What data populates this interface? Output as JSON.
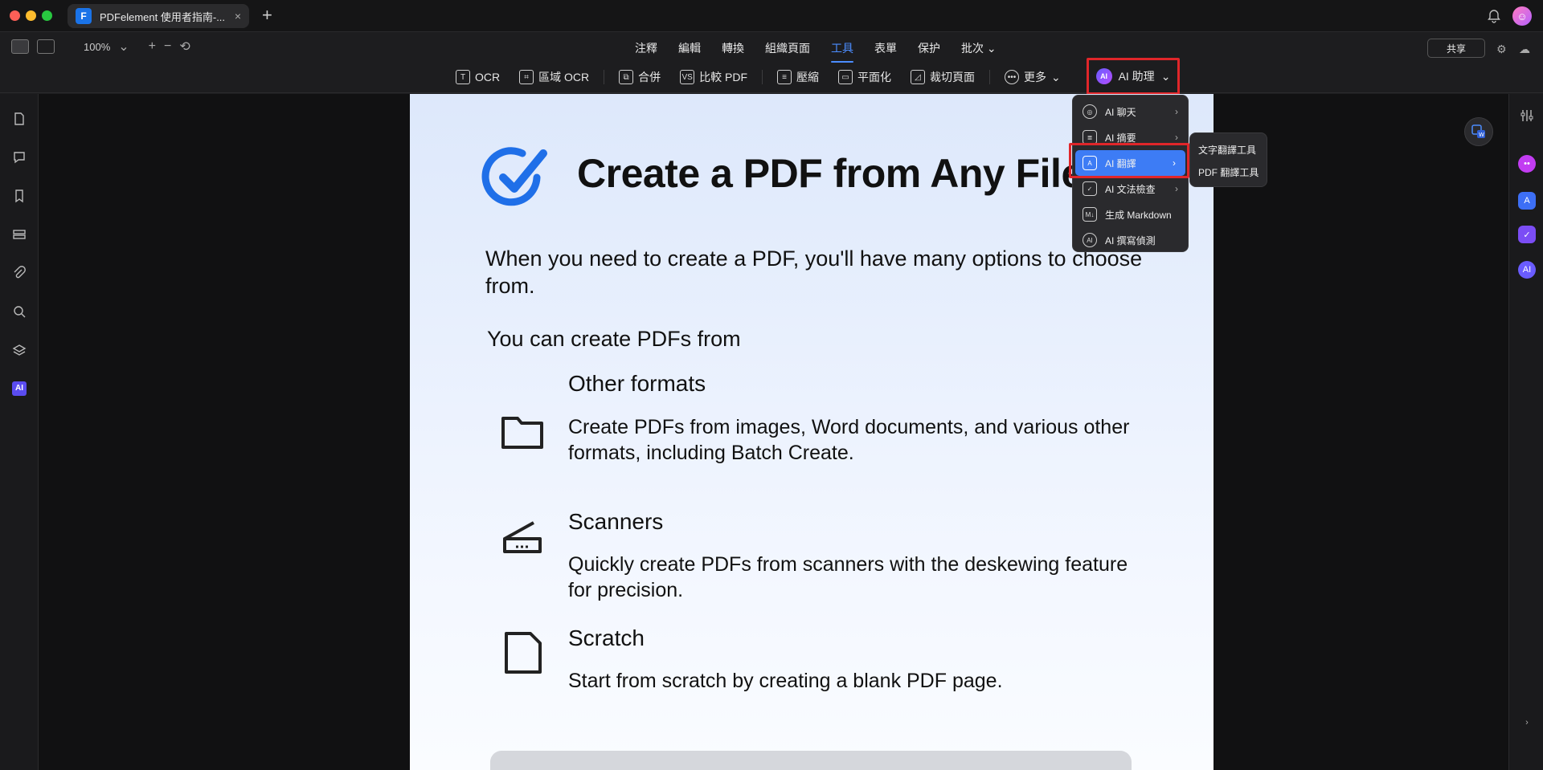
{
  "tab": {
    "title": "PDFelement 使用者指南-...",
    "close": "×"
  },
  "new_tab": "+",
  "zoom": {
    "value": "100%",
    "chevron": "⌄",
    "plus": "+",
    "minus": "−"
  },
  "menu": [
    "注釋",
    "編輯",
    "轉換",
    "組織頁面",
    "工具",
    "表單",
    "保护",
    "批次"
  ],
  "menu_active_index": 4,
  "menu_more_chevron": "⌄",
  "share_label": "共享",
  "tools": {
    "ocr": "OCR",
    "area_ocr": "區域 OCR",
    "merge": "合併",
    "compare": "比較 PDF",
    "compress": "壓縮",
    "flatten": "平面化",
    "crop": "裁切頁面",
    "more": "更多",
    "ai_assistant": "AI 助理",
    "ai_badge": "AI"
  },
  "ai_menu": [
    {
      "label": "AI 聊天",
      "icon": "ai-chat-icon",
      "has_submenu": true
    },
    {
      "label": "AI 摘要",
      "icon": "ai-summary-icon",
      "has_submenu": true
    },
    {
      "label": "AI 翻譯",
      "icon": "ai-translate-icon",
      "has_submenu": true,
      "highlighted": true
    },
    {
      "label": "AI 文法檢查",
      "icon": "ai-grammar-icon",
      "has_submenu": true
    },
    {
      "label": "生成 Markdown",
      "icon": "markdown-icon",
      "has_submenu": false
    },
    {
      "label": "AI 撰寫偵測",
      "icon": "ai-detect-icon",
      "has_submenu": false
    }
  ],
  "ai_submenu": [
    "文字翻譯工具",
    "PDF 翻譯工具"
  ],
  "left_sidebar_ai": "AI",
  "page": {
    "title": "Create a PDF from Any File",
    "intro": "When you need to create a PDF, you'll have many options to choose from.",
    "subtitle": "You can create PDFs from",
    "sections": [
      {
        "heading": "Other formats",
        "text": "Create PDFs from images, Word documents, and various other formats, including Batch Create."
      },
      {
        "heading": "Scanners",
        "text": "Quickly create PDFs from scanners with the deskewing feature for precision."
      },
      {
        "heading": "Scratch",
        "text": "Start from scratch by creating a blank PDF page."
      }
    ]
  },
  "colors": {
    "accent": "#3d7cf5",
    "highlight_box": "#e0262a",
    "brand": "#1a73e8"
  }
}
